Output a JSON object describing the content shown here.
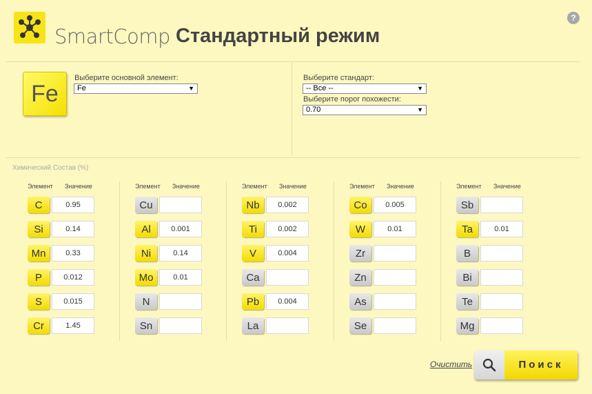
{
  "header": {
    "brand": "SmartComp",
    "mode_title": "Стандартный режим",
    "help_label": "?"
  },
  "element_select": {
    "symbol": "Fe",
    "label": "Выберите основной элемент:",
    "value": "Fe"
  },
  "standard_select": {
    "label": "Выберите стандарт:",
    "value": "-- Все --"
  },
  "threshold_select": {
    "label": "Выберите порог похожести:",
    "value": "0.70"
  },
  "composition": {
    "title": "Химический Состав (%)",
    "col_element": "Элемент",
    "col_value": "Значение",
    "columns": [
      [
        {
          "symbol": "C",
          "value": "0.95",
          "active": true
        },
        {
          "symbol": "Si",
          "value": "0.14",
          "active": true
        },
        {
          "symbol": "Mn",
          "value": "0.33",
          "active": true
        },
        {
          "symbol": "P",
          "value": "0.012",
          "active": true
        },
        {
          "symbol": "S",
          "value": "0.015",
          "active": true
        },
        {
          "symbol": "Cr",
          "value": "1.45",
          "active": true
        }
      ],
      [
        {
          "symbol": "Cu",
          "value": "",
          "active": false
        },
        {
          "symbol": "Al",
          "value": "0.001",
          "active": true
        },
        {
          "symbol": "Ni",
          "value": "0.14",
          "active": true
        },
        {
          "symbol": "Mo",
          "value": "0.01",
          "active": true
        },
        {
          "symbol": "N",
          "value": "",
          "active": false
        },
        {
          "symbol": "Sn",
          "value": "",
          "active": false
        }
      ],
      [
        {
          "symbol": "Nb",
          "value": "0.002",
          "active": true
        },
        {
          "symbol": "Ti",
          "value": "0.002",
          "active": true
        },
        {
          "symbol": "V",
          "value": "0.004",
          "active": true
        },
        {
          "symbol": "Ca",
          "value": "",
          "active": false
        },
        {
          "symbol": "Pb",
          "value": "0.004",
          "active": true
        },
        {
          "symbol": "La",
          "value": "",
          "active": false
        }
      ],
      [
        {
          "symbol": "Co",
          "value": "0.005",
          "active": true
        },
        {
          "symbol": "W",
          "value": "0.01",
          "active": true
        },
        {
          "symbol": "Zr",
          "value": "",
          "active": false
        },
        {
          "symbol": "Zn",
          "value": "",
          "active": false
        },
        {
          "symbol": "As",
          "value": "",
          "active": false
        },
        {
          "symbol": "Se",
          "value": "",
          "active": false
        }
      ],
      [
        {
          "symbol": "Sb",
          "value": "",
          "active": false
        },
        {
          "symbol": "Ta",
          "value": "0.01",
          "active": true
        },
        {
          "symbol": "B",
          "value": "",
          "active": false
        },
        {
          "symbol": "Bi",
          "value": "",
          "active": false
        },
        {
          "symbol": "Te",
          "value": "",
          "active": false
        },
        {
          "symbol": "Mg",
          "value": "",
          "active": false
        }
      ]
    ]
  },
  "actions": {
    "clear_label": "Очистить",
    "search_label": "Поиск",
    "search_icon": "magnifier-icon"
  },
  "colors": {
    "background": "#fdf8c0",
    "accent_yellow": "#f3dc00",
    "inactive_gray": "#c9c9c9"
  }
}
